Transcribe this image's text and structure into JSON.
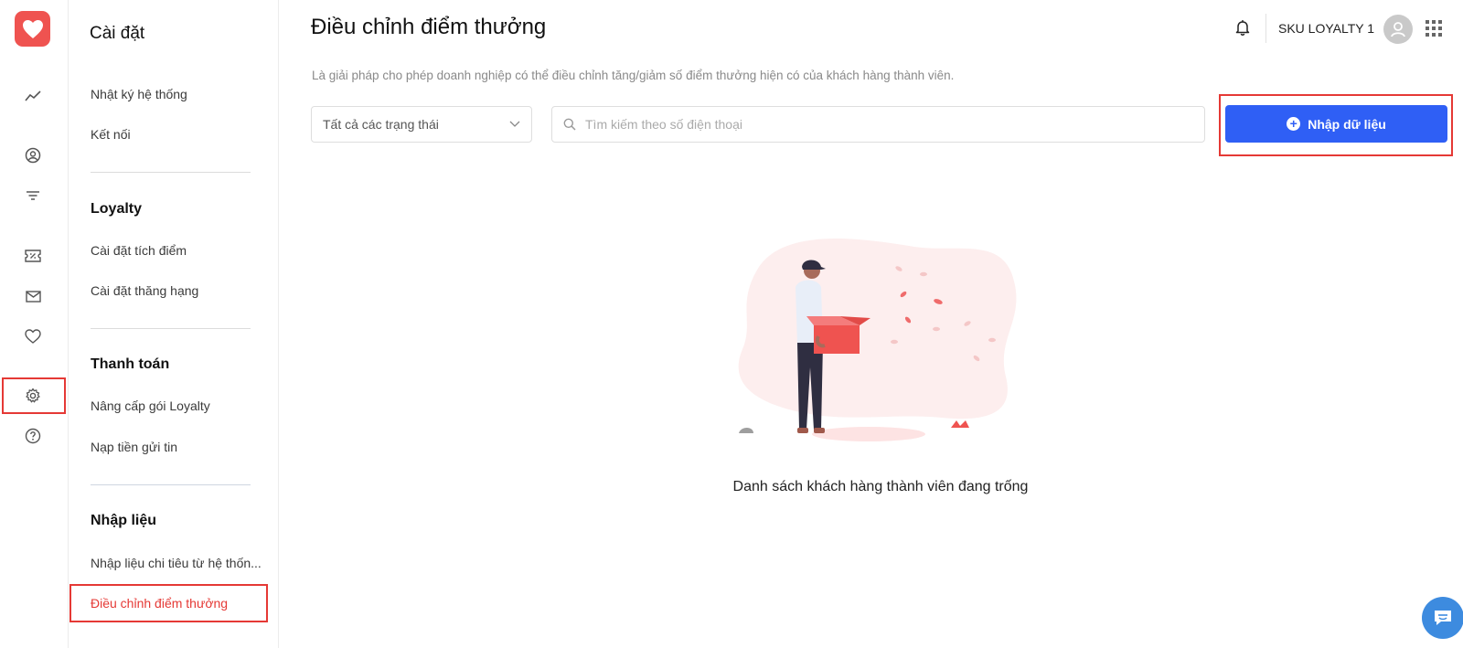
{
  "header": {
    "page_title": "Điều chỉnh điểm thưởng",
    "user_name": "SKU LOYALTY 1"
  },
  "description": "Là giải pháp cho phép doanh nghiệp có thể điều chỉnh tăng/giảm số điểm thưởng hiện có của khách hàng thành viên.",
  "filters": {
    "status_select": "Tất cả các trạng thái",
    "search_placeholder": "Tìm kiếm theo số điện thoại"
  },
  "actions": {
    "import_label": "Nhập dữ liệu"
  },
  "settings_menu": {
    "title": "Cài đặt",
    "items": [
      "Nhật ký hệ thống",
      "Kết nối"
    ],
    "sections": [
      {
        "heading": "Loyalty",
        "items": [
          "Cài đặt tích điểm",
          "Cài đặt thăng hạng"
        ]
      },
      {
        "heading": "Thanh toán",
        "items": [
          "Nâng cấp gói Loyalty",
          "Nạp tiền gửi tin"
        ]
      },
      {
        "heading": "Nhập liệu",
        "items": [
          "Nhập liệu chi tiêu từ hệ thốn...",
          "Điều chỉnh điểm thưởng"
        ]
      }
    ],
    "active_item": "Điều chỉnh điểm thưởng"
  },
  "rail": {
    "icons": [
      "chart-line-icon",
      "user-circle-icon",
      "filter-icon",
      "coupon-icon",
      "mail-icon",
      "heart-icon",
      "gear-icon",
      "help-icon"
    ],
    "active": "gear-icon"
  },
  "empty_state": {
    "message": "Danh sách khách hàng thành viên đang trống"
  },
  "colors": {
    "brand": "#ef5350",
    "primary_button": "#2f5ff5",
    "highlight": "#e53935",
    "active_menu": "#e53935"
  }
}
